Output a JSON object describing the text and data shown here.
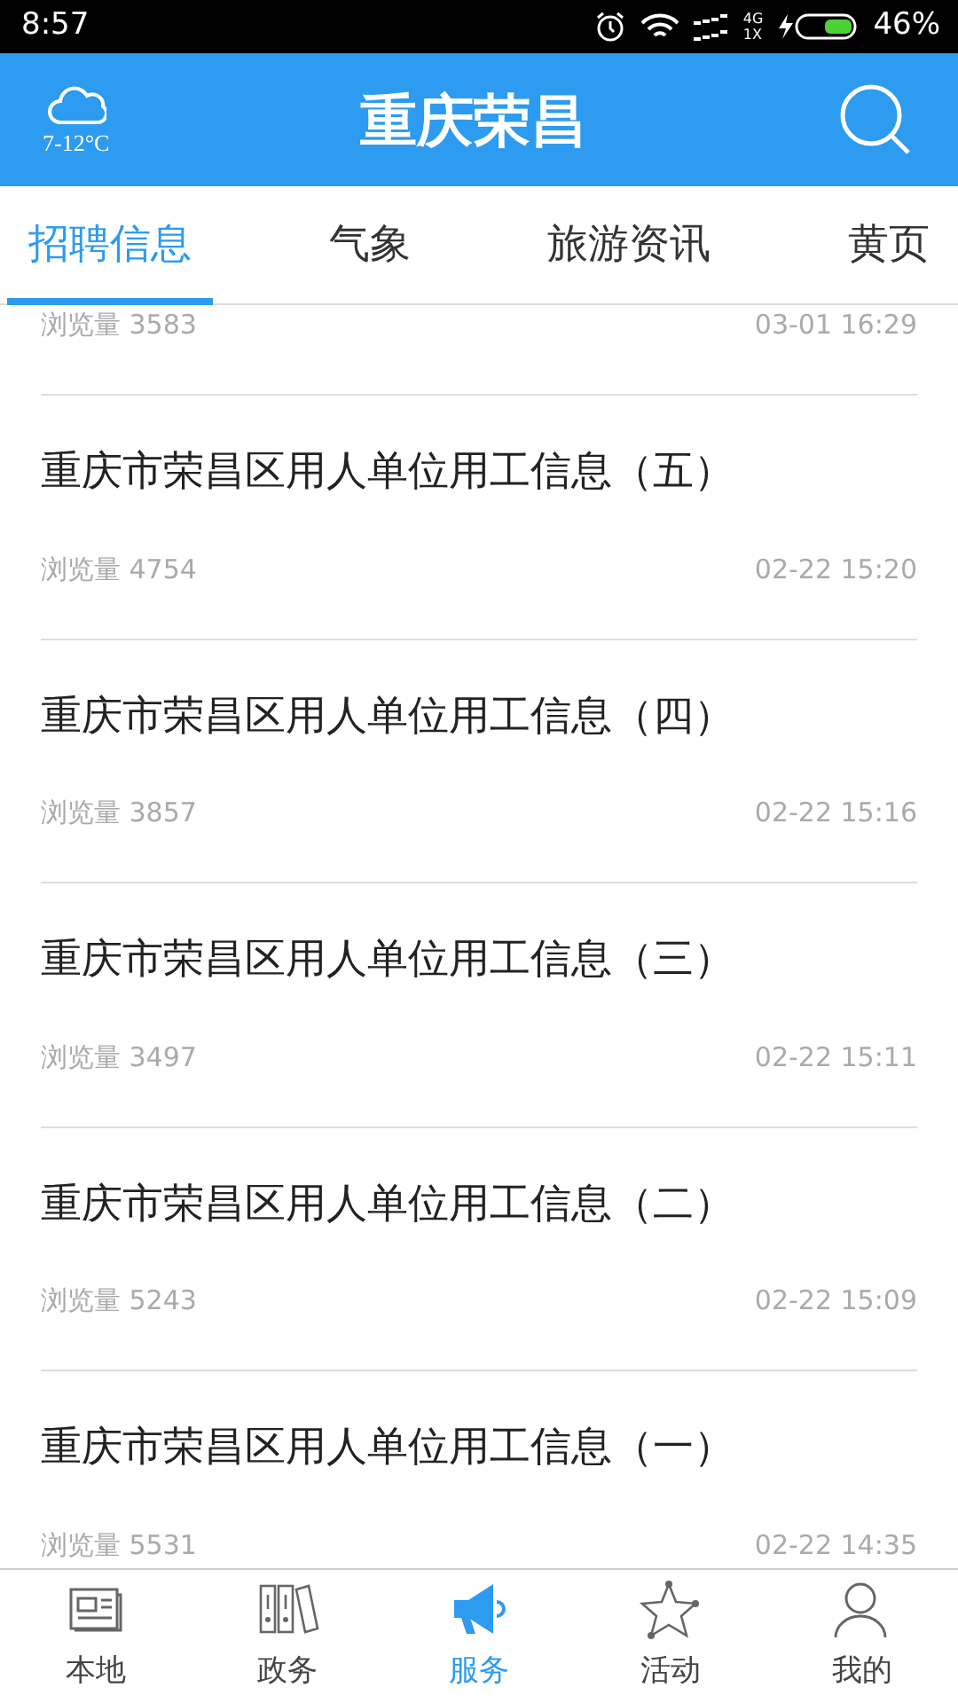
{
  "status_bar": {
    "time": "8:57",
    "network_top": "4G",
    "network_bottom": "1X",
    "battery": "46%"
  },
  "header": {
    "temperature": "7-12°C",
    "title": "重庆荣昌"
  },
  "tabs": [
    {
      "label": "招聘信息",
      "selected": true
    },
    {
      "label": "气象",
      "selected": false
    },
    {
      "label": "旅游资讯",
      "selected": false
    },
    {
      "label": "黄页",
      "selected": false
    }
  ],
  "articles": [
    {
      "views": "浏览量 3583",
      "time": "03-01 16:29"
    },
    {
      "title": "重庆市荣昌区用人单位用工信息（五）",
      "views": "浏览量 4754",
      "time": "02-22 15:20"
    },
    {
      "title": "重庆市荣昌区用人单位用工信息（四）",
      "views": "浏览量 3857",
      "time": "02-22 15:16"
    },
    {
      "title": "重庆市荣昌区用人单位用工信息（三）",
      "views": "浏览量 3497",
      "time": "02-22 15:11"
    },
    {
      "title": "重庆市荣昌区用人单位用工信息（二）",
      "views": "浏览量 5243",
      "time": "02-22 15:09"
    },
    {
      "title": "重庆市荣昌区用人单位用工信息（一）",
      "views": "浏览量 5531",
      "time": "02-22 14:35"
    }
  ],
  "bottom_nav": [
    {
      "label": "本地",
      "kind": "newspaper",
      "selected": false
    },
    {
      "label": "政务",
      "kind": "folders",
      "selected": false
    },
    {
      "label": "服务",
      "kind": "megaphone",
      "selected": true
    },
    {
      "label": "活动",
      "kind": "star",
      "selected": false
    },
    {
      "label": "我的",
      "kind": "person",
      "selected": false
    }
  ]
}
